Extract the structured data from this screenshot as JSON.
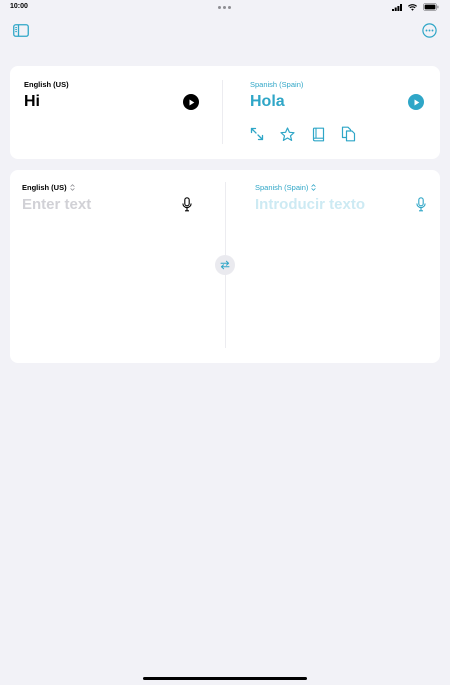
{
  "status_bar": {
    "time": "10:00",
    "icons": [
      "cellular-signal-icon",
      "wifi-icon",
      "battery-icon"
    ]
  },
  "toolbar": {
    "left_icon": "sidebar-icon",
    "right_icon": "ellipsis-circle-icon"
  },
  "result": {
    "source_language": "English (US)",
    "source_text": "Hi",
    "target_language": "Spanish (Spain)",
    "target_text": "Hola",
    "actions": [
      "expand-icon",
      "star-icon",
      "dictionary-icon",
      "copy-icon"
    ]
  },
  "input": {
    "source_language": "English (US)",
    "source_placeholder": "Enter text",
    "target_language": "Spanish (Spain)",
    "target_placeholder": "Introducir texto"
  },
  "colors": {
    "accent": "#2fa6c7",
    "background": "#f2f2f7",
    "card": "#ffffff"
  }
}
